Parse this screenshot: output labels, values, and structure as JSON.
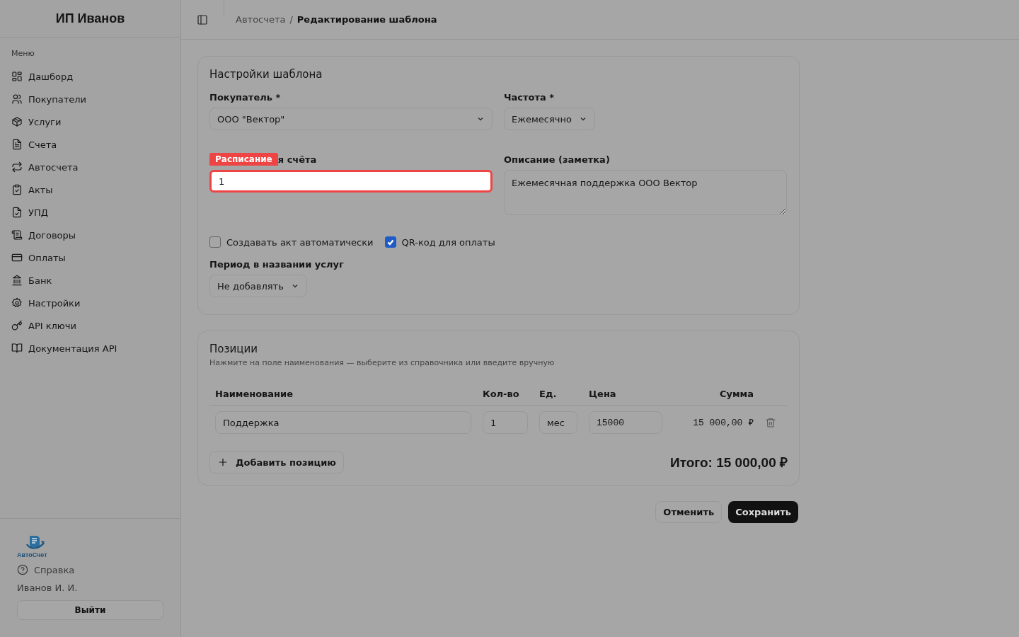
{
  "sidebar": {
    "title": "ИП Иванов",
    "menu_label": "Меню",
    "items": [
      {
        "label": "Дашборд"
      },
      {
        "label": "Покупатели"
      },
      {
        "label": "Услуги"
      },
      {
        "label": "Счета"
      },
      {
        "label": "Автосчета"
      },
      {
        "label": "Акты"
      },
      {
        "label": "УПД"
      },
      {
        "label": "Договоры"
      },
      {
        "label": "Оплаты"
      },
      {
        "label": "Банк"
      },
      {
        "label": "Настройки"
      },
      {
        "label": "API ключи"
      },
      {
        "label": "Документация API"
      }
    ],
    "logo_text": "АвтоСчет",
    "help": "Справка",
    "user": "Иванов И. И.",
    "logout": "Выйти"
  },
  "breadcrumb_separator": "/",
  "breadcrumbs": [
    {
      "label": "Автосчета",
      "current": false
    },
    {
      "label": "Редактирование шаблона",
      "current": true
    }
  ],
  "settings": {
    "title": "Настройки шаблона",
    "buyer": {
      "label": "Покупатель *",
      "value": "ООО \"Вектор\""
    },
    "frequency": {
      "label": "Частота *",
      "value": "Ежемесячно"
    },
    "day": {
      "label": "я счёта",
      "value": "1",
      "highlighted": true,
      "tour_badge": "Расписание"
    },
    "description": {
      "label": "Описание (заметка)",
      "value": "Ежемесячная поддержка ООО Вектор"
    },
    "checkboxes": [
      {
        "label": "Создавать акт автоматически",
        "checked": false
      },
      {
        "label": "QR-код для оплаты",
        "checked": true
      }
    ],
    "period": {
      "label": "Период в названии услуг",
      "value": "Не добавлять"
    }
  },
  "positions": {
    "title": "Позиции",
    "hint": "Нажмите на поле наименования — выберите из справочника или введите вручную",
    "columns": [
      "Наименование",
      "Кол-во",
      "Ед.",
      "Цена",
      "Сумма"
    ],
    "rows": [
      {
        "name": "Поддержка",
        "qty": "1",
        "unit": "мес",
        "price": "15000",
        "sum": "15 000,00 ₽"
      }
    ],
    "add_button": "Добавить позицию",
    "total": "Итого: 15 000,00 ₽"
  },
  "actions": {
    "cancel": "Отменить",
    "save": "Сохранить"
  }
}
